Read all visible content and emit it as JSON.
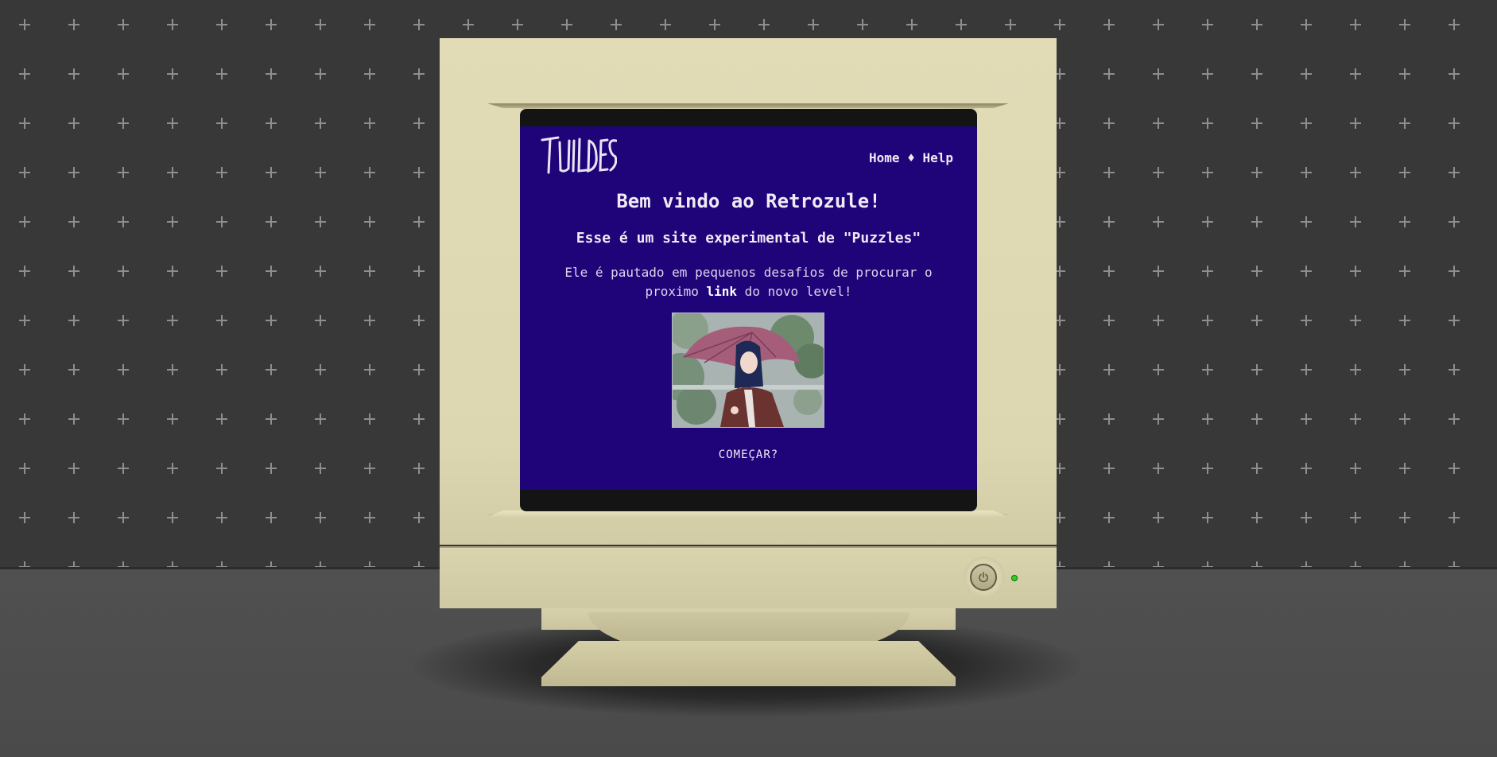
{
  "site": {
    "logo_text": "TWILDES"
  },
  "nav": {
    "home": "Home",
    "separator": "♦",
    "help": "Help"
  },
  "content": {
    "title": "Bem vindo ao Retrozule!",
    "subtitle": "Esse é um site experimental de \"Puzzles\"",
    "desc_part1": "Ele é pautado em pequenos desafios de procurar o proximo ",
    "desc_bold": "link",
    "desc_part2": " do novo level!",
    "start_label": "COMEÇAR?"
  },
  "colors": {
    "screen_bg": "#1f0379",
    "bezel": "#ddd7b1",
    "wall": "#383838",
    "led": "#2bd421"
  },
  "icons": {
    "power": "power-icon"
  }
}
